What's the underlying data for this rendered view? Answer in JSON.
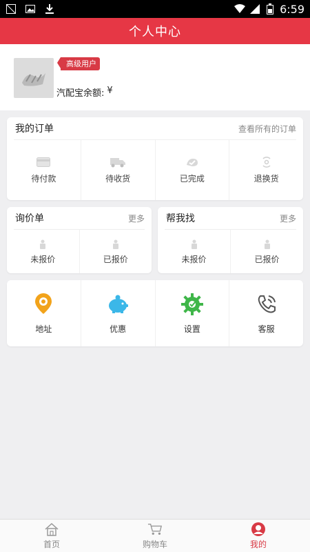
{
  "status_bar": {
    "time": "6:59"
  },
  "header": {
    "title": "个人中心"
  },
  "profile": {
    "badge": "高级用户",
    "balance_label": "汽配宝余额:",
    "balance_currency": "¥"
  },
  "orders": {
    "title": "我的订单",
    "view_all": "查看所有的订单",
    "items": [
      {
        "label": "待付款",
        "icon": "card-icon"
      },
      {
        "label": "待收货",
        "icon": "truck-icon"
      },
      {
        "label": "已完成",
        "icon": "done-icon"
      },
      {
        "label": "退换货",
        "icon": "return-icon"
      }
    ]
  },
  "inquiry": {
    "title": "询价单",
    "more": "更多",
    "items": [
      {
        "label": "未报价"
      },
      {
        "label": "已报价"
      }
    ]
  },
  "help_find": {
    "title": "帮我找",
    "more": "更多",
    "items": [
      {
        "label": "未报价"
      },
      {
        "label": "已报价"
      }
    ]
  },
  "services": {
    "items": [
      {
        "label": "地址",
        "icon": "location-icon",
        "color": "#f2a31b"
      },
      {
        "label": "优惠",
        "icon": "piggy-bank-icon",
        "color": "#3bb7e8"
      },
      {
        "label": "设置",
        "icon": "gear-icon",
        "color": "#3fb649"
      },
      {
        "label": "客服",
        "icon": "phone-icon",
        "color": "#555555"
      }
    ]
  },
  "tabbar": {
    "items": [
      {
        "label": "首页",
        "icon": "home-icon"
      },
      {
        "label": "购物车",
        "icon": "cart-icon"
      },
      {
        "label": "我的",
        "icon": "user-icon"
      }
    ],
    "active": "我的"
  },
  "colors": {
    "brand_red": "#e63745",
    "background": "#efeff1"
  }
}
